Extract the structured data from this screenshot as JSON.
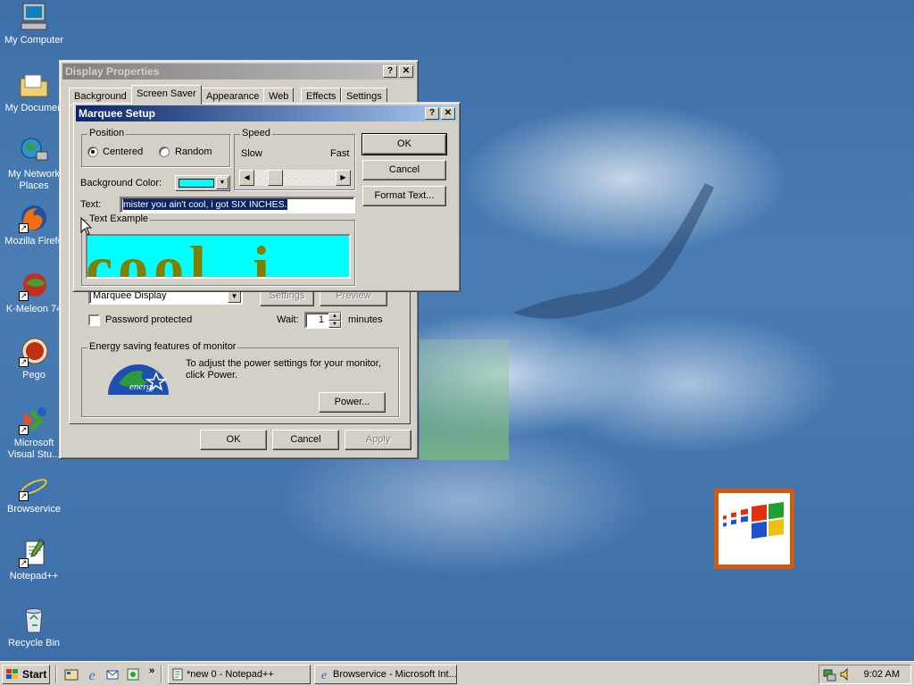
{
  "desktop_icons": [
    {
      "label": "My Computer",
      "icon": "my-computer-icon"
    },
    {
      "label": "My Documen",
      "icon": "folder-icon"
    },
    {
      "label": "My Network Places",
      "icon": "network-places-icon"
    },
    {
      "label": "Mozilla Firefo",
      "icon": "firefox-icon"
    },
    {
      "label": "K-Meleon 74",
      "icon": "k-meleon-icon"
    },
    {
      "label": "Pego",
      "icon": "pego-icon"
    },
    {
      "label": "Microsoft Visual Stu...",
      "icon": "visual-studio-icon"
    },
    {
      "label": "Browservice",
      "icon": "internet-explorer-icon"
    },
    {
      "label": "Notepad++",
      "icon": "notepad-plus-icon"
    },
    {
      "label": "Recycle Bin",
      "icon": "recycle-bin-icon"
    }
  ],
  "display_props": {
    "title": "Display Properties",
    "tabs": [
      "Background",
      "Screen Saver",
      "Appearance",
      "Web",
      "Effects",
      "Settings"
    ],
    "selected_tab": "Screen Saver",
    "screensaver_value": "Marquee Display",
    "settings_label": "Settings",
    "preview_label": "Preview",
    "password_label": "Password protected",
    "wait_label": "Wait:",
    "wait_value": "1",
    "minutes_label": "minutes",
    "energy_group": "Energy saving features of monitor",
    "energy_text": "To adjust the power settings for your monitor, click Power.",
    "power_button": "Power...",
    "ok": "OK",
    "cancel": "Cancel",
    "apply": "Apply"
  },
  "marquee": {
    "title": "Marquee Setup",
    "position_group": "Position",
    "centered": "Centered",
    "random": "Random",
    "speed_group": "Speed",
    "slow": "Slow",
    "fast": "Fast",
    "speed_level": 0.2,
    "bg_color_label": "Background Color:",
    "bg_color": "#00ffff",
    "text_label": "Text:",
    "text_value": "mister you ain't cool, i got SIX INCHES.",
    "example_group": "Text Example",
    "example_text": "cool, i",
    "example_text_color": "#808000",
    "ok": "OK",
    "cancel": "Cancel",
    "format_text": "Format Text..."
  },
  "taskbar": {
    "start": "Start",
    "quick_launch": [
      "show-desktop-icon",
      "internet-explorer-icon",
      "outlook-icon",
      "channels-icon"
    ],
    "chevron": "»",
    "tasks": [
      "*new  0 - Notepad++",
      "Browservice - Microsoft Int..."
    ],
    "clock": "9:02 AM"
  },
  "colors": {
    "desktop": "#3a6ea5",
    "title_active": "#0a246a",
    "face": "#d4d0c8"
  }
}
